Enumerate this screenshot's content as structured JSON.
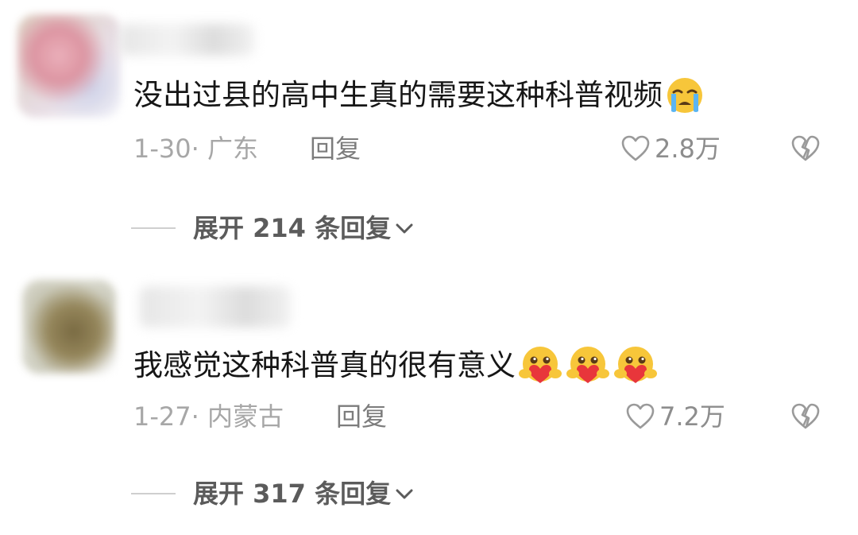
{
  "comments": [
    {
      "text": "没出过县的高中生真的需要这种科普视频",
      "emoji_icons": [
        "crying-face-icon"
      ],
      "date": "1-30",
      "separator": "·",
      "location": "广东",
      "reply_label": "回复",
      "likes": "2.8万",
      "expand_label": "展开 214 条回复"
    },
    {
      "text": "我感觉这种科普真的很有意义",
      "emoji_icons": [
        "hugging-heart-icon",
        "hugging-heart-icon",
        "hugging-heart-icon"
      ],
      "date": "1-27",
      "separator": "·",
      "location": "内蒙古",
      "reply_label": "回复",
      "likes": "7.2万",
      "expand_label": "展开 317 条回复"
    }
  ],
  "colors": {
    "text": "#161616",
    "meta": "#a7a7a7",
    "reply": "#7c7c7c",
    "expand": "#5b5b5b",
    "heart_red": "#e8363b",
    "emoji_yellow": "#f7c63a"
  }
}
